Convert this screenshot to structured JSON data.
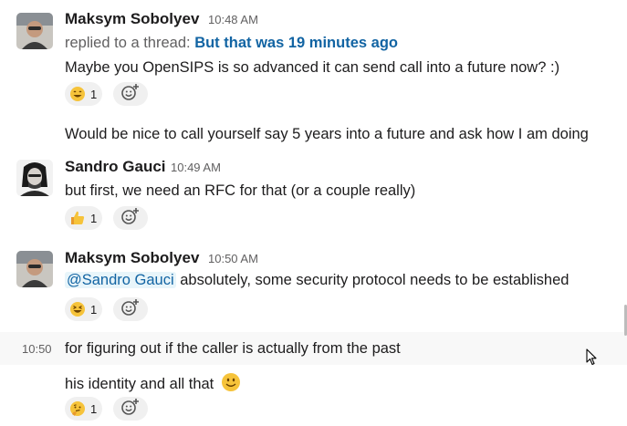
{
  "messages": [
    {
      "author": "Maksym Sobolyev",
      "time": "10:48 AM",
      "thread_prefix": "replied to a thread:",
      "thread_title": "But that was 19 minutes ago",
      "text": "Maybe you OpenSIPS is so advanced it can send call into a future now? :)",
      "reaction_count": "1",
      "followup_text": "Would be nice to call yourself say 5 years into a future and ask how I am doing"
    },
    {
      "author": "Sandro Gauci",
      "time": "10:49 AM",
      "text": "but first, we need an RFC for that (or a couple really)",
      "reaction_count": "1"
    },
    {
      "author": "Maksym Sobolyev",
      "time": "10:50 AM",
      "mention": "@Sandro Gauci",
      "text": " absolutely, some security protocol needs to be established",
      "reaction_count": "1",
      "followup_time": "10:50",
      "followup_text": "for figuring out if the caller is actually from the past",
      "followup_text2": "his identity and all that",
      "followup_reaction_count": "1"
    }
  ],
  "colors": {
    "link": "#1264a3",
    "mention_bg": "#e8f5fa",
    "reaction_bg": "#f0f0f0",
    "muted_text": "#616061"
  },
  "icons": [
    "smile-emoji-icon",
    "thumbs-up-emoji-icon",
    "laughing-emoji-icon",
    "thinking-emoji-icon",
    "add-reaction-icon",
    "smiley-inline-emoji-icon",
    "mouse-cursor-icon"
  ]
}
